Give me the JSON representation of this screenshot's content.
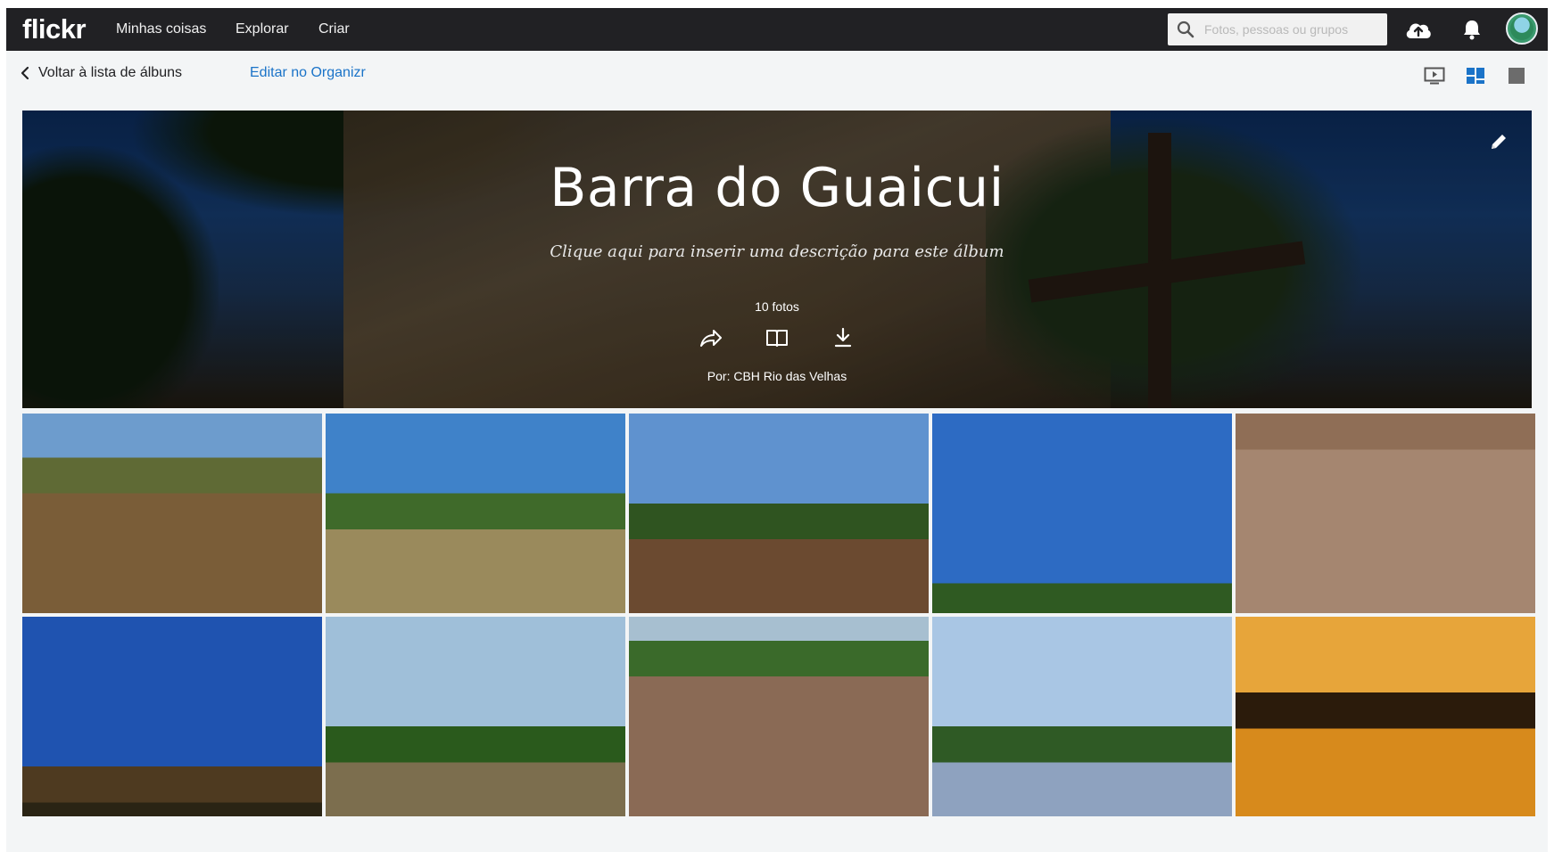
{
  "header": {
    "logo": "flickr",
    "nav": [
      "Minhas coisas",
      "Explorar",
      "Criar"
    ],
    "search_placeholder": "Fotos, pessoas ou grupos"
  },
  "subbar": {
    "back_label": "Voltar à lista de álbuns",
    "edit_label": "Editar no Organizr"
  },
  "album": {
    "title": "Barra do Guaicui",
    "description": "Clique aqui para inserir uma descrição para este álbum",
    "count": "10 fotos",
    "author": "Por: CBH Rio das Velhas"
  },
  "colors": {
    "nav_bg": "#212124",
    "link": "#1a73c8",
    "active_view": "#1a73c8"
  },
  "photos": [
    {
      "name": "river-boat-bow",
      "top": "#6d9ccd",
      "mid": "#5f6a35",
      "bottom": "#7a5d38",
      "horizon": 0.22
    },
    {
      "name": "river-clouds",
      "top": "#3f82c9",
      "mid": "#3f6a2a",
      "bottom": "#9a8a5c",
      "horizon": 0.4
    },
    {
      "name": "river-trees",
      "top": "#5f92cf",
      "mid": "#2f5420",
      "bottom": "#6b4a30",
      "horizon": 0.45
    },
    {
      "name": "big-tree",
      "top": "#2d6bc3",
      "mid": "#2f5a22",
      "bottom": "#a0907a",
      "horizon": 0.85
    },
    {
      "name": "canoe-brown-water",
      "top": "#9a7a62",
      "mid": "#8f6e56",
      "bottom": "#a58670",
      "horizon": 0.0
    },
    {
      "name": "ruined-church",
      "top": "#1f53b0",
      "mid": "#4e3a20",
      "bottom": "#2a2414",
      "horizon": 0.75
    },
    {
      "name": "motorboat-river",
      "top": "#9fbfd9",
      "mid": "#2a5a1c",
      "bottom": "#7c6e4e",
      "horizon": 0.55
    },
    {
      "name": "blue-boat-aerial",
      "top": "#a7bfd0",
      "mid": "#3a6a2a",
      "bottom": "#8a6a55",
      "horizon": 0.12
    },
    {
      "name": "fishing-net",
      "top": "#a9c6e4",
      "mid": "#2f5a25",
      "bottom": "#8ea2bf",
      "horizon": 0.55
    },
    {
      "name": "sunset-river",
      "top": "#e7a53a",
      "mid": "#2b1b0b",
      "bottom": "#d78a1c",
      "horizon": 0.38
    }
  ]
}
